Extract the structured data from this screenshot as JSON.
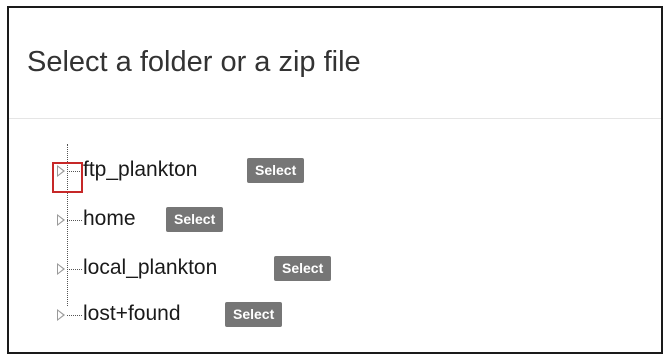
{
  "dialog": {
    "title": "Select a folder or a zip file"
  },
  "tree": {
    "nodes": [
      {
        "label": "ftp_plankton",
        "button": "Select"
      },
      {
        "label": "home",
        "button": "Select"
      },
      {
        "label": "local_plankton",
        "button": "Select"
      },
      {
        "label": "lost+found",
        "button": "Select"
      }
    ]
  },
  "icons": {
    "expander": "triangle-right-icon"
  },
  "colors": {
    "button_bg": "#767676",
    "button_text": "#ffffff",
    "highlight_border": "#c62828",
    "dialog_border": "#1a1a1a"
  }
}
